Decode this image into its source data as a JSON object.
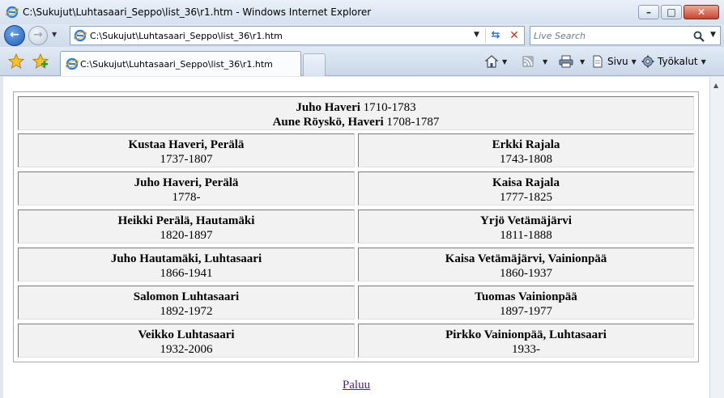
{
  "window": {
    "title": "C:\\Sukujut\\Luhtasaari_Seppo\\list_36\\r1.htm - Windows Internet Explorer",
    "minimize_glyph": "–",
    "maximize_glyph": "□",
    "close_glyph": "✕"
  },
  "navigation": {
    "back_glyph": "←",
    "forward_glyph": "→",
    "address_value": "C:\\Sukujut\\Luhtasaari_Seppo\\list_36\\r1.htm",
    "refresh_glyph": "⇆",
    "stop_glyph": "✕",
    "search_placeholder": "Live Search"
  },
  "tabs": [
    {
      "label": "C:\\Sukujut\\Luhtasaari_Seppo\\list_36\\r1.htm"
    }
  ],
  "commands": {
    "page_label": "Sivu",
    "tools_label": "Työkalut"
  },
  "pedigree": {
    "root": {
      "line1_name": "Juho Haveri",
      "line1_years": "1710-1783",
      "line2_name": "Aune Röyskö, Haveri",
      "line2_years": "1708-1787"
    },
    "rows": [
      {
        "left": {
          "name": "Kustaa Haveri, Perälä",
          "years": "1737-1807"
        },
        "right": {
          "name": "Erkki Rajala",
          "years": "1743-1808"
        }
      },
      {
        "left": {
          "name": "Juho Haveri, Perälä",
          "years": "1778-"
        },
        "right": {
          "name": "Kaisa Rajala",
          "years": "1777-1825"
        }
      },
      {
        "left": {
          "name": "Heikki Perälä, Hautamäki",
          "years": "1820-1897"
        },
        "right": {
          "name": "Yrjö Vetämäjärvi",
          "years": "1811-1888"
        }
      },
      {
        "left": {
          "name": "Juho Hautamäki, Luhtasaari",
          "years": "1866-1941"
        },
        "right": {
          "name": "Kaisa Vetämäjärvi, Vainionpää",
          "years": "1860-1937"
        }
      },
      {
        "left": {
          "name": "Salomon Luhtasaari",
          "years": "1892-1972"
        },
        "right": {
          "name": "Tuomas Vainionpää",
          "years": "1897-1977"
        }
      },
      {
        "left": {
          "name": "Veikko Luhtasaari",
          "years": "1932-2006"
        },
        "right": {
          "name": "Pirkko Vainionpää, Luhtasaari",
          "years": "1933-"
        }
      }
    ],
    "back_link": "Paluu"
  }
}
